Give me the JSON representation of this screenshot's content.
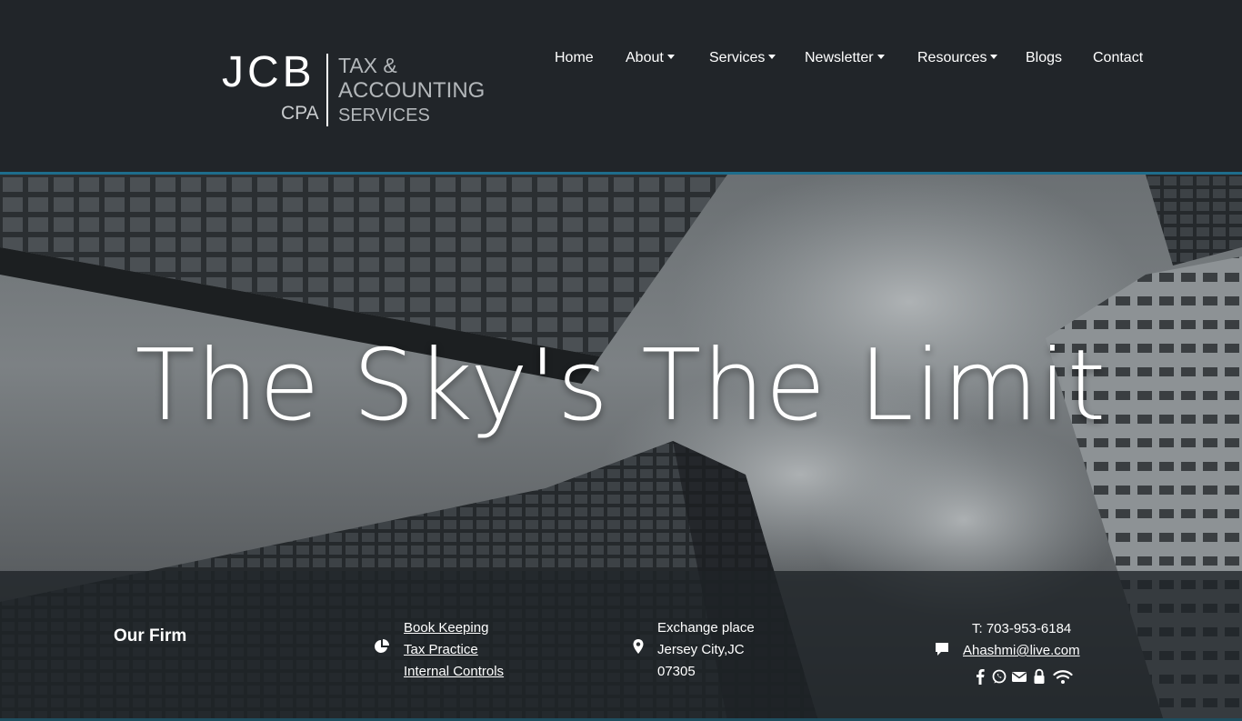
{
  "logo": {
    "initials": "JCB",
    "designation": "CPA",
    "line1": "TAX &",
    "line2": "ACCOUNTING",
    "line3": "SERVICES"
  },
  "nav": {
    "items": [
      {
        "label": "Home",
        "dropdown": false
      },
      {
        "label": "About",
        "dropdown": true
      },
      {
        "label": "Services",
        "dropdown": true
      },
      {
        "label": "Newsletter",
        "dropdown": true
      },
      {
        "label": "Resources",
        "dropdown": true
      },
      {
        "label": "Blogs",
        "dropdown": false
      },
      {
        "label": "Contact",
        "dropdown": false
      }
    ]
  },
  "hero": {
    "title": "The Sky's The Limit"
  },
  "footer": {
    "heading": "Our Firm",
    "services_icon": "pie-chart-icon",
    "services": [
      "Book Keeping",
      "Tax Practice",
      "Internal Controls"
    ],
    "address_icon": "map-marker-icon",
    "address": [
      "Exchange place",
      "Jersey City,JC",
      "07305"
    ],
    "contact_icon": "comment-icon",
    "phone": "T: 703-953-6184",
    "email": "Ahashmi@live.com",
    "social_icons": [
      "facebook-icon",
      "whatsapp-icon",
      "envelope-icon",
      "lock-icon",
      "wifi-icon"
    ]
  },
  "colors": {
    "header_bg": "#212529",
    "accent": "#1e6d8c",
    "text": "#ffffff"
  }
}
